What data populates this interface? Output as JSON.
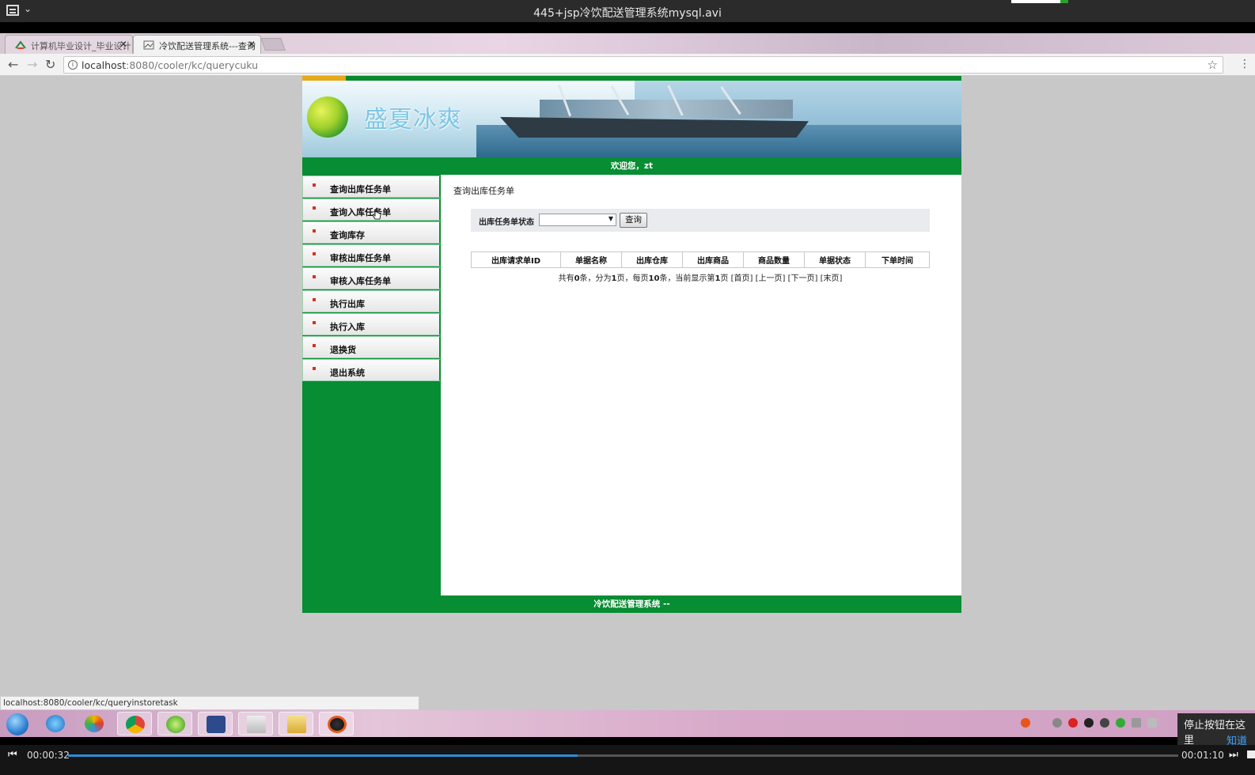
{
  "player": {
    "title": "445+jsp冷饮配送管理系统mysql.avi",
    "elapsed": "00:00:32",
    "total": "00:01:10",
    "progress": 0.459
  },
  "browser": {
    "tabs": [
      {
        "label": "计算机毕业设计_毕业设计",
        "active": false
      },
      {
        "label": "冷饮配送管理系统---查询",
        "active": true
      }
    ],
    "url_host": "localhost",
    "url_rest": ":8080/cooler/kc/querycuku",
    "status_url": "localhost:8080/cooler/kc/queryinstoretask"
  },
  "page": {
    "brand": "盛夏冰爽",
    "welcome": "欢迎您，zt",
    "sidebar": [
      {
        "label": "查询出库任务单"
      },
      {
        "label": "查询入库任务单"
      },
      {
        "label": "查询库存"
      },
      {
        "label": "审核出库任务单"
      },
      {
        "label": "审核入库任务单"
      },
      {
        "label": "执行出库"
      },
      {
        "label": "执行入库"
      },
      {
        "label": "退换货"
      },
      {
        "label": "退出系统"
      }
    ],
    "heading": "查询出库任务单",
    "search": {
      "label": "出库任务单状态",
      "selected": "",
      "button": "查询"
    },
    "table": {
      "columns": [
        "出库请求单ID",
        "单据名称",
        "出库仓库",
        "出库商品",
        "商品数量",
        "单据状态",
        "下单时间"
      ],
      "rows": []
    },
    "pager": {
      "prefix": "共有",
      "total": "0",
      "mid1": "条，分为",
      "pages": "1",
      "mid2": "页，每页",
      "per_page": "10",
      "mid3": "条，当前显示第",
      "current": "1",
      "mid4": "页",
      "first": "[首页]",
      "prev": "[上一页]",
      "next": "[下一页]",
      "last": "[末页]"
    },
    "footer": "冷饮配送管理系统 --"
  },
  "notification": {
    "text": "停止按钮在这里",
    "link": "知道了"
  }
}
